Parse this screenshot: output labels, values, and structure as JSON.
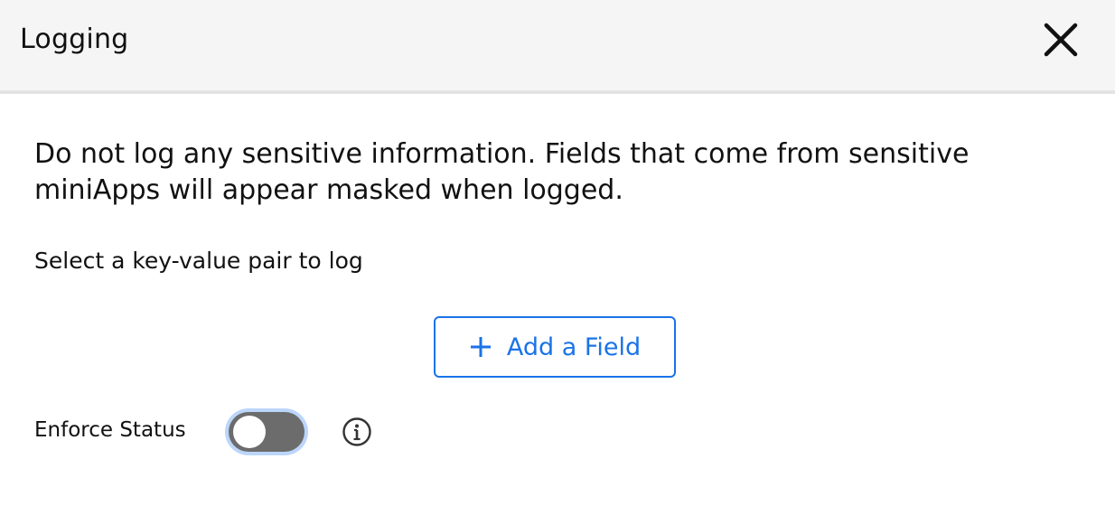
{
  "dialog": {
    "title": "Logging",
    "close_icon": "close-icon"
  },
  "body": {
    "warning_text": "Do not log any sensitive information. Fields that come from sensitive miniApps will appear masked when logged.",
    "subheading": "Select a key-value pair to log",
    "add_field": {
      "label": "Add a Field",
      "icon": "plus-icon"
    },
    "enforce": {
      "label": "Enforce Status",
      "toggle_on": false,
      "info_icon": "info-icon"
    }
  },
  "colors": {
    "accent": "#1a73e8",
    "header_bg": "#f5f5f5",
    "toggle_track": "#6c6c6c",
    "toggle_focus_ring": "#bcd6fb"
  }
}
